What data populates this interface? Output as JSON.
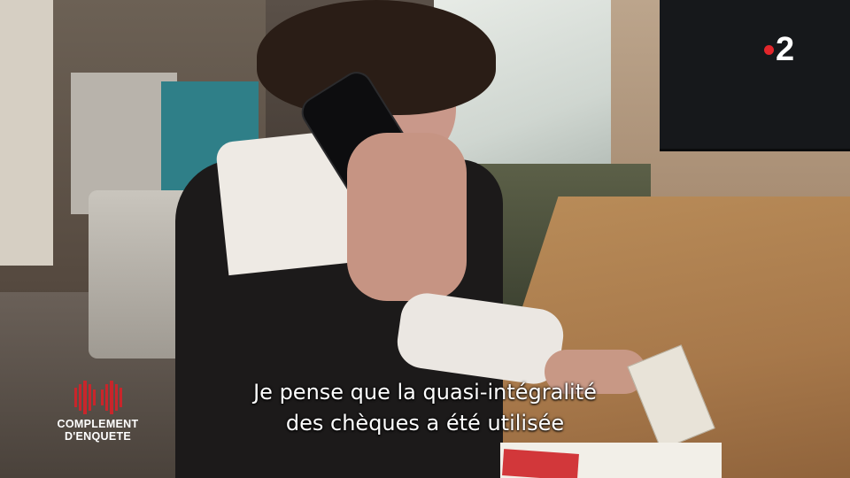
{
  "subtitle": {
    "line1": "Je pense que la quasi-intégralité",
    "line2": "des chèques a été utilisée"
  },
  "channel_logo": {
    "number": "2",
    "dot_color": "#e3262b"
  },
  "show_logo": {
    "line1": "COMPLEMENT",
    "line2": "D'ENQUETE",
    "mark_color": "#c8262b"
  }
}
